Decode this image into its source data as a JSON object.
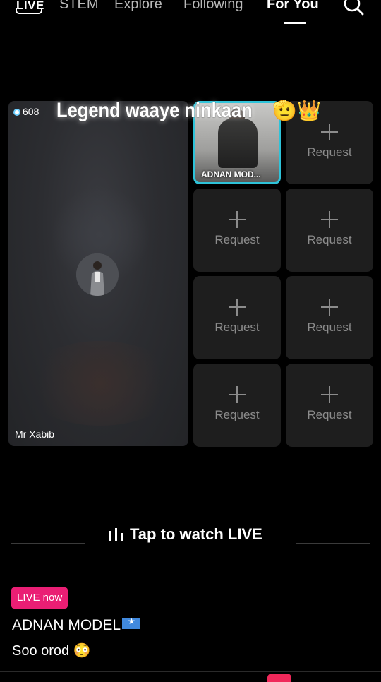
{
  "nav": {
    "live_logo": "LIVE",
    "tabs": [
      "STEM",
      "Explore",
      "Following",
      "For You"
    ],
    "active_tab": "For You"
  },
  "stream": {
    "viewer_count": "608",
    "title": "Legend waaye ninkaan",
    "title_emoji": "🫡👑",
    "host_name": "Mr Xabib",
    "guest_name": "ADNAN MOD...",
    "request_label": "Request",
    "guest_border_color": "#2ec3d9"
  },
  "cta": {
    "tap_to_watch": "Tap to watch LIVE"
  },
  "post": {
    "live_badge": "LIVE now",
    "creator": "ADNAN MODEL",
    "caption": "Soo orod 😳",
    "badge_color": "#ea1e74"
  },
  "icons": [
    "live-logo-icon",
    "search-icon",
    "plus-icon",
    "bars-icon",
    "somalia-flag-icon"
  ]
}
